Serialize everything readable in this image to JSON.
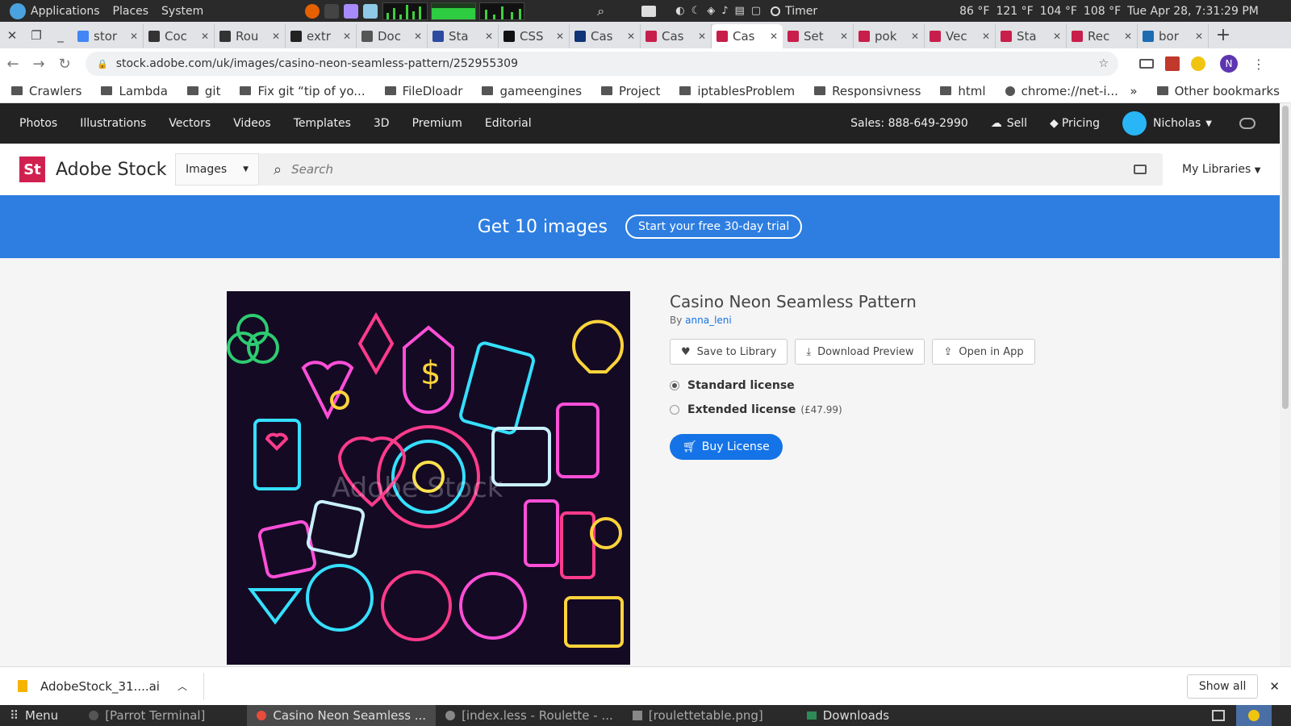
{
  "system": {
    "menus": [
      "Applications",
      "Places",
      "System"
    ],
    "timer": "Timer",
    "temps": [
      "86 °F",
      "121 °F",
      "104 °F",
      "108 °F"
    ],
    "clock": "Tue Apr 28, 7:31:29 PM"
  },
  "tabs": [
    {
      "label": "stor",
      "color": "#4285f4"
    },
    {
      "label": "Coc",
      "color": "#333"
    },
    {
      "label": "Rou",
      "color": "#333"
    },
    {
      "label": "extr",
      "color": "#222"
    },
    {
      "label": "Doc",
      "color": "#555"
    },
    {
      "label": "Sta",
      "color": "#2c4ba0"
    },
    {
      "label": "CSS",
      "color": "#111"
    },
    {
      "label": "Cas",
      "color": "#137"
    },
    {
      "label": "Cas",
      "color": "#c81e4b"
    },
    {
      "label": "Cas",
      "color": "#c81e4b",
      "active": true
    },
    {
      "label": "Set",
      "color": "#c81e4b"
    },
    {
      "label": "pok",
      "color": "#c81e4b"
    },
    {
      "label": "Vec",
      "color": "#c81e4b"
    },
    {
      "label": "Sta",
      "color": "#c81e4b"
    },
    {
      "label": "Rec",
      "color": "#c81e4b"
    },
    {
      "label": "bor",
      "color": "#1d6bb3"
    }
  ],
  "url": "stock.adobe.com/uk/images/casino-neon-seamless-pattern/252955309",
  "bookmarks": [
    "Crawlers",
    "Lambda",
    "git",
    "Fix git “tip of yo...",
    "FileDloadr",
    "gameengines",
    "Project",
    "iptablesProblem",
    "Responsivness",
    "html",
    "chrome://net-i...",
    "Other bookmarks"
  ],
  "topnav": {
    "items": [
      "Photos",
      "Illustrations",
      "Vectors",
      "Videos",
      "Templates",
      "3D",
      "Premium",
      "Editorial"
    ],
    "sales": "Sales: 888-649-2990",
    "sell": "Sell",
    "pricing": "Pricing",
    "user": "Nicholas"
  },
  "header": {
    "logo": "St",
    "brand": "Adobe Stock",
    "select": "Images",
    "search_placeholder": "Search",
    "libraries": "My Libraries"
  },
  "banner": {
    "text": "Get 10 images",
    "cta": "Start your free 30-day trial"
  },
  "asset": {
    "title": "Casino Neon Seamless Pattern",
    "by": "By",
    "author": "anna_leni",
    "watermark": "Adobe Stock",
    "save": "Save to Library",
    "download": "Download Preview",
    "open": "Open in App",
    "standard": "Standard license",
    "extended": "Extended license",
    "extended_price": "(£47.99)",
    "buy": "Buy License"
  },
  "download_bar": {
    "file": "AdobeStock_31....ai",
    "show_all": "Show all"
  },
  "taskbar": {
    "menu": "Menu",
    "windows": [
      "[Parrot Terminal]",
      "Casino Neon Seamless ...",
      "[index.less - Roulette - ...",
      "[roulettetable.png]",
      "Downloads"
    ]
  },
  "colors": {
    "accent": "#1473e6",
    "banner": "#2d7ee0",
    "brand": "#d02050"
  }
}
